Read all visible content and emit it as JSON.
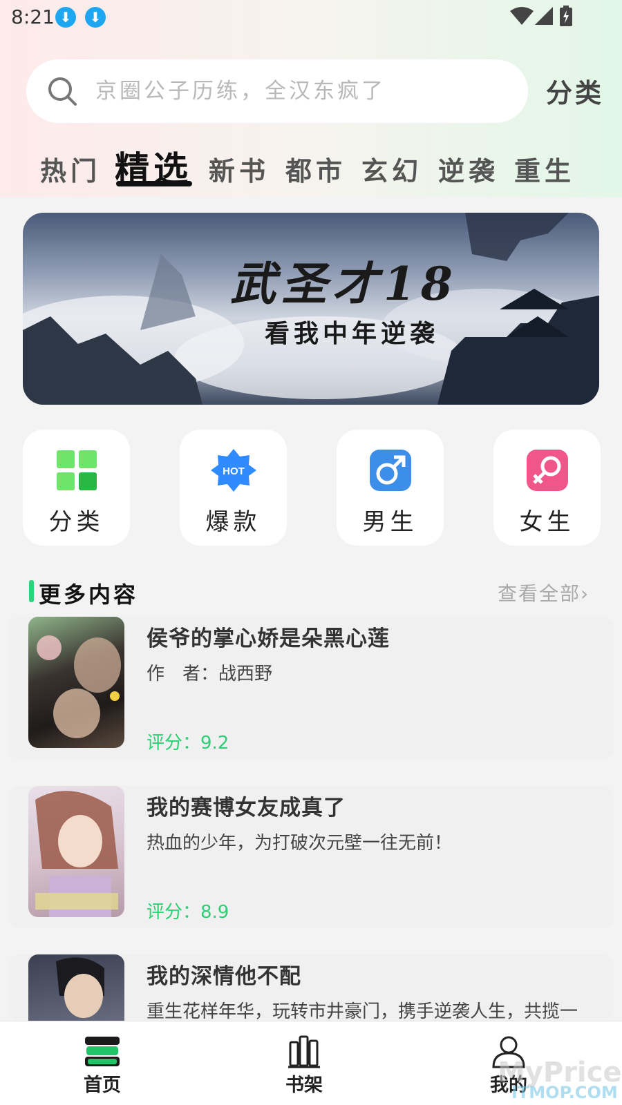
{
  "status_bar": {
    "time": "8:21"
  },
  "search": {
    "placeholder": "京圈公子历练，全汉东疯了"
  },
  "category_link": "分类",
  "tabs": [
    {
      "label": "热门",
      "active": false
    },
    {
      "label": "精选",
      "active": true
    },
    {
      "label": "新书",
      "active": false
    },
    {
      "label": "都市",
      "active": false
    },
    {
      "label": "玄幻",
      "active": false
    },
    {
      "label": "逆袭",
      "active": false
    },
    {
      "label": "重生",
      "active": false
    }
  ],
  "banner": {
    "title": "武圣才18",
    "subtitle": "看我中年逆袭"
  },
  "quick_entries": [
    {
      "label": "分类",
      "icon": "grid-icon",
      "color": "#3fd34f"
    },
    {
      "label": "爆款",
      "icon": "hot-icon",
      "color": "#2f8bff",
      "badge": "HOT"
    },
    {
      "label": "男生",
      "icon": "male-icon",
      "color": "#3d8ee8"
    },
    {
      "label": "女生",
      "icon": "female-icon",
      "color": "#f0568a"
    }
  ],
  "section": {
    "title": "更多内容",
    "view_all": "查看全部"
  },
  "books": [
    {
      "title": "侯爷的掌心娇是朵黑心莲",
      "desc": "作　者：战西野",
      "score": "评分：9.2"
    },
    {
      "title": "我的赛博女友成真了",
      "desc": "热血的少年，为打破次元壁一往无前！",
      "score": "评分：8.9"
    },
    {
      "title": "我的深情他不配",
      "desc": "重生花样年华，玩转市井豪门，携手逆袭人生，共揽一",
      "score": ""
    }
  ],
  "bottom_nav": [
    {
      "label": "首页",
      "icon": "home-book-icon",
      "active": true
    },
    {
      "label": "书架",
      "icon": "bookshelf-icon",
      "active": false
    },
    {
      "label": "我的",
      "icon": "profile-icon",
      "active": false
    }
  ],
  "watermark": {
    "line1": "MyPrice",
    "line2": "ITMOP.COM"
  },
  "colors": {
    "accent": "#2bcf74",
    "tab_active": "#111111"
  }
}
